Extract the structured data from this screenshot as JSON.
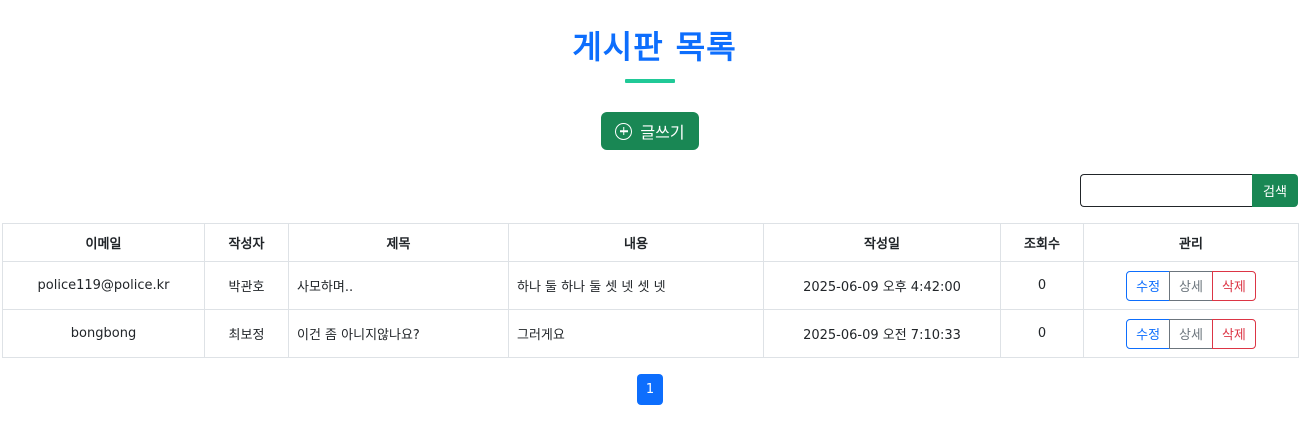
{
  "header": {
    "title": "게시판 목록",
    "write_label": "글쓰기"
  },
  "search": {
    "value": "",
    "placeholder": "",
    "button_label": "검색"
  },
  "table": {
    "columns": [
      "이메일",
      "작성자",
      "제목",
      "내용",
      "작성일",
      "조회수",
      "관리"
    ],
    "rows": [
      {
        "email": "police119@police.kr",
        "author": "박관호",
        "title": "사모하며..",
        "content": "하나 둘 하나 둘 셋 넷 셋 넷",
        "date": "2025-06-09 오후 4:42:00",
        "views": "0"
      },
      {
        "email": "bongbong",
        "author": "최보정",
        "title": "이건 좀 아니지않나요?",
        "content": "그러게요",
        "date": "2025-06-09 오전 7:10:33",
        "views": "0"
      }
    ],
    "actions": {
      "edit_label": "수정",
      "detail_label": "상세",
      "delete_label": "삭제"
    }
  },
  "pagination": {
    "current_page": "1"
  },
  "colors": {
    "title": "#0d6efd",
    "underline": "#20c997",
    "success": "#198754",
    "primary": "#0d6efd",
    "secondary": "#6c757d",
    "danger": "#dc3545"
  },
  "icons": {
    "write": "plus-circle-icon"
  }
}
